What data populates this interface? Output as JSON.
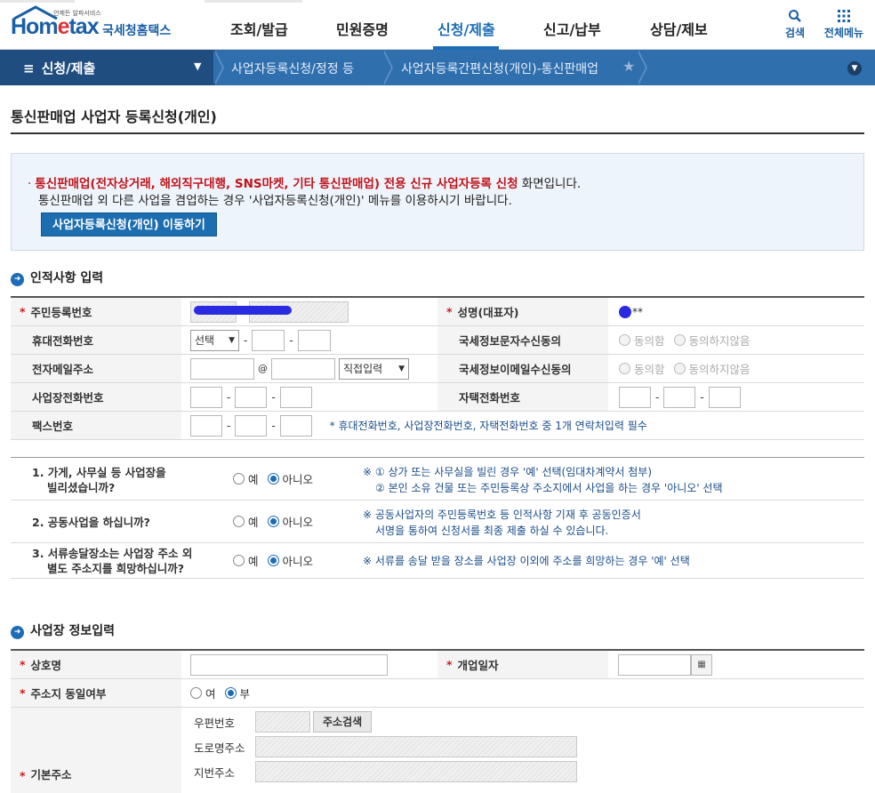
{
  "header": {
    "logo_small": "언제든 알파서비스",
    "logo_main_a": "Hom",
    "logo_main_b": "e",
    "logo_main_c": "tax",
    "logo_org": "국세청홈택스",
    "gnb": [
      "조회/발급",
      "민원증명",
      "신청/제출",
      "신고/납부",
      "상담/제보"
    ],
    "active_index": 2,
    "search_label": "검색",
    "allmenu_label": "전체메뉴"
  },
  "nav": {
    "menu_label": "신청/제출",
    "crumb1": "사업자등록신청/정정 등",
    "crumb2": "사업자등록간편신청(개인)-통신판매업"
  },
  "page": {
    "title": "통신판매업 사업자 등록신청(개인)"
  },
  "notice": {
    "bullet": "·",
    "red_text": "통신판매업(전자상거래, 해외직구대행, SNS마켓, 기타 통신판매업) 전용 신규 사업자등록 신청",
    "black_text": " 화면입니다.",
    "line2": "통신판매업 외 다른 사업을 겸업하는 경우 '사업자등록신청(개인)' 메뉴를 이용하시기 바랍니다.",
    "button": "사업자등록신청(개인) 이동하기"
  },
  "personal": {
    "section_title": "인적사항 입력",
    "rrn_label": "주민등록번호",
    "name_label": "성명(대표자)",
    "name_suffix": "**",
    "mobile_label": "휴대전화번호",
    "mobile_select": "선택",
    "sms_consent_label": "국세정보문자수신동의",
    "agree": "동의함",
    "disagree": "동의하지않음",
    "email_label": "전자메일주소",
    "at": "@",
    "email_select": "직접입력",
    "email_consent_label": "국세정보이메일수신동의",
    "biz_phone_label": "사업장전화번호",
    "home_phone_label": "자택전화번호",
    "fax_label": "팩스번호",
    "contact_note": "* 휴대전화번호, 사업장전화번호, 자택전화번호 중 1개 연락처입력 필수",
    "req_mark": "*",
    "dash": "-"
  },
  "questions": {
    "yes": "예",
    "no": "아니오",
    "q1a": "1. 가게, 사무실 등 사업장을",
    "q1b": "빌리셨습니까?",
    "q1n1": "※ ① 상가 또는 사무실을 빌린 경우 '예' 선택(임대차계약서 첨부)",
    "q1n2": "② 본인 소유 건물 또는 주민등록상 주소지에서 사업을 하는 경우 '아니오' 선택",
    "q2": "2. 공동사업을 하십니까?",
    "q2n1": "※ 공동사업자의 주민등록번호 등 인적사항 기재 후 공동인증서",
    "q2n2": "서명을 통하여 신청서를 최종 제출 하실 수 있습니다.",
    "q3a": "3. 서류송달장소는 사업장 주소 외",
    "q3b": "별도 주소지를 희망하십니까?",
    "q3n": "※ 서류를 송달 받을 장소를 사업장 이외에 주소를 희망하는 경우 '예' 선택"
  },
  "business": {
    "section_title": "사업장 정보입력",
    "trade_name_label": "상호명",
    "open_date_label": "개업일자",
    "same_addr_label": "주소지 동일여부",
    "yes": "여",
    "no": "부",
    "zip_label": "우편번호",
    "addr_search_btn": "주소검색",
    "road_label": "도로명주소",
    "basic_addr_label": "기본주소",
    "lot_label": "지번주소"
  }
}
